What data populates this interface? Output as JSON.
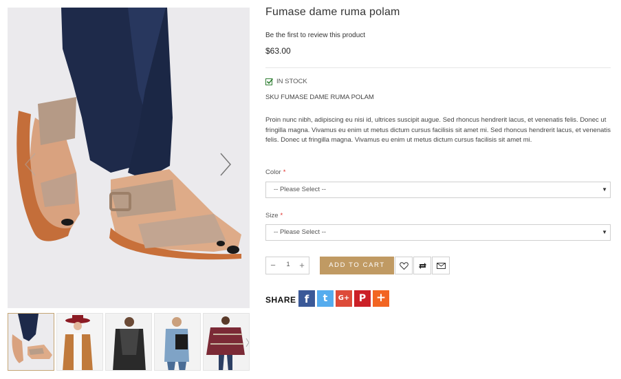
{
  "product": {
    "title": "Fumase dame ruma polam",
    "review_link": "Be the first to review this product",
    "price": "$63.00",
    "stock": "IN STOCK",
    "sku": "SKU FUMASE DAME RUMA POLAM",
    "description": "Proin nunc nibh, adipiscing eu nisi id, ultrices suscipit augue. Sed rhoncus hendrerit lacus, et venenatis felis. Donec ut fringilla magna. Vivamus eu enim ut metus dictum cursus facilisis sit amet mi.  Sed rhoncus hendrerit lacus, et venenatis felis. Donec ut fringilla magna. Vivamus eu enim ut metus dictum cursus facilisis sit amet mi."
  },
  "options": {
    "color_label": "Color",
    "color_value": "-- Please Select --",
    "size_label": "Size",
    "size_value": "-- Please Select --",
    "required_mark": "*"
  },
  "cart": {
    "qty": "1",
    "minus": "−",
    "plus": "+",
    "add_to_cart": "ADD TO CART"
  },
  "share": {
    "label": "SHARE",
    "facebook": "f",
    "twitter": "t",
    "google": "G+",
    "pinterest": "P",
    "more": "+"
  },
  "colors": {
    "accent": "#c09a63",
    "facebook": "#3b5998",
    "twitter": "#55acee",
    "google": "#dd4b39",
    "pinterest": "#cb2027",
    "more": "#f26522",
    "stock_check": "#2e7d32"
  },
  "gallery": {
    "thumbnails": [
      "sandals",
      "red-hat-outfit",
      "black-scarf-outfit",
      "denim-backpack-outfit",
      "plaid-poncho-outfit"
    ]
  }
}
